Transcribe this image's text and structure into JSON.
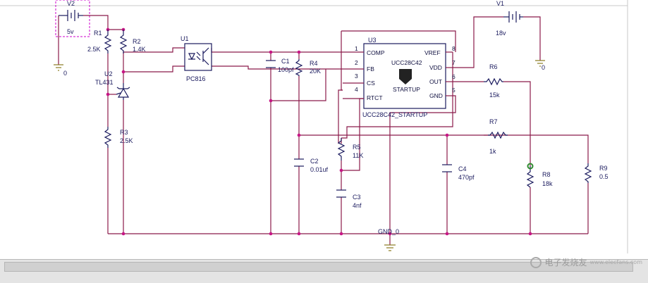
{
  "parts": {
    "v2": {
      "ref": "V2",
      "value": "5v"
    },
    "v1": {
      "ref": "V1",
      "value": "18v"
    },
    "r1": {
      "ref": "R1",
      "value": "2.5K"
    },
    "r2": {
      "ref": "R2",
      "value": "1.4K"
    },
    "r3": {
      "ref": "R3",
      "value": "2.5K"
    },
    "r4": {
      "ref": "R4",
      "value": "20K"
    },
    "r5": {
      "ref": "R5",
      "value": "11K"
    },
    "r6": {
      "ref": "R6",
      "value": "15k"
    },
    "r7": {
      "ref": "R7",
      "value": "1k"
    },
    "r8": {
      "ref": "R8",
      "value": "18k"
    },
    "r9": {
      "ref": "R9",
      "value": "0.5"
    },
    "c1": {
      "ref": "C1",
      "value": "100pf"
    },
    "c2": {
      "ref": "C2",
      "value": "0.01uf"
    },
    "c3": {
      "ref": "C3",
      "value": "4nf"
    },
    "c4": {
      "ref": "C4",
      "value": "470pf"
    },
    "u1": {
      "ref": "U1",
      "part": "PC816"
    },
    "u2": {
      "ref": "U2",
      "part": "TL431"
    },
    "u3": {
      "ref": "U3",
      "part": "UCC28C42_STARTUP"
    }
  },
  "ic": {
    "chip_title": "UCC28C42",
    "chip_sub": "STARTUP",
    "pins_left": [
      {
        "num": "1",
        "name": "COMP"
      },
      {
        "num": "2",
        "name": "FB"
      },
      {
        "num": "3",
        "name": "CS"
      },
      {
        "num": "4",
        "name": "RTCT"
      }
    ],
    "pins_right": [
      {
        "num": "8",
        "name": "VREF"
      },
      {
        "num": "7",
        "name": "VDD"
      },
      {
        "num": "6",
        "name": "OUT"
      },
      {
        "num": "5",
        "name": "GND"
      }
    ]
  },
  "nets": {
    "ground": "GND_0",
    "ground_left": "0",
    "ground_right": "0"
  },
  "watermark": {
    "text": "电子发烧友",
    "site": "www.elecfans.com"
  },
  "colors": {
    "wire": "#8b1a4a",
    "part": "#1a1a5e",
    "junction": "#c71585",
    "ground": "#8a7a20",
    "probe": "#2e8b2e"
  }
}
